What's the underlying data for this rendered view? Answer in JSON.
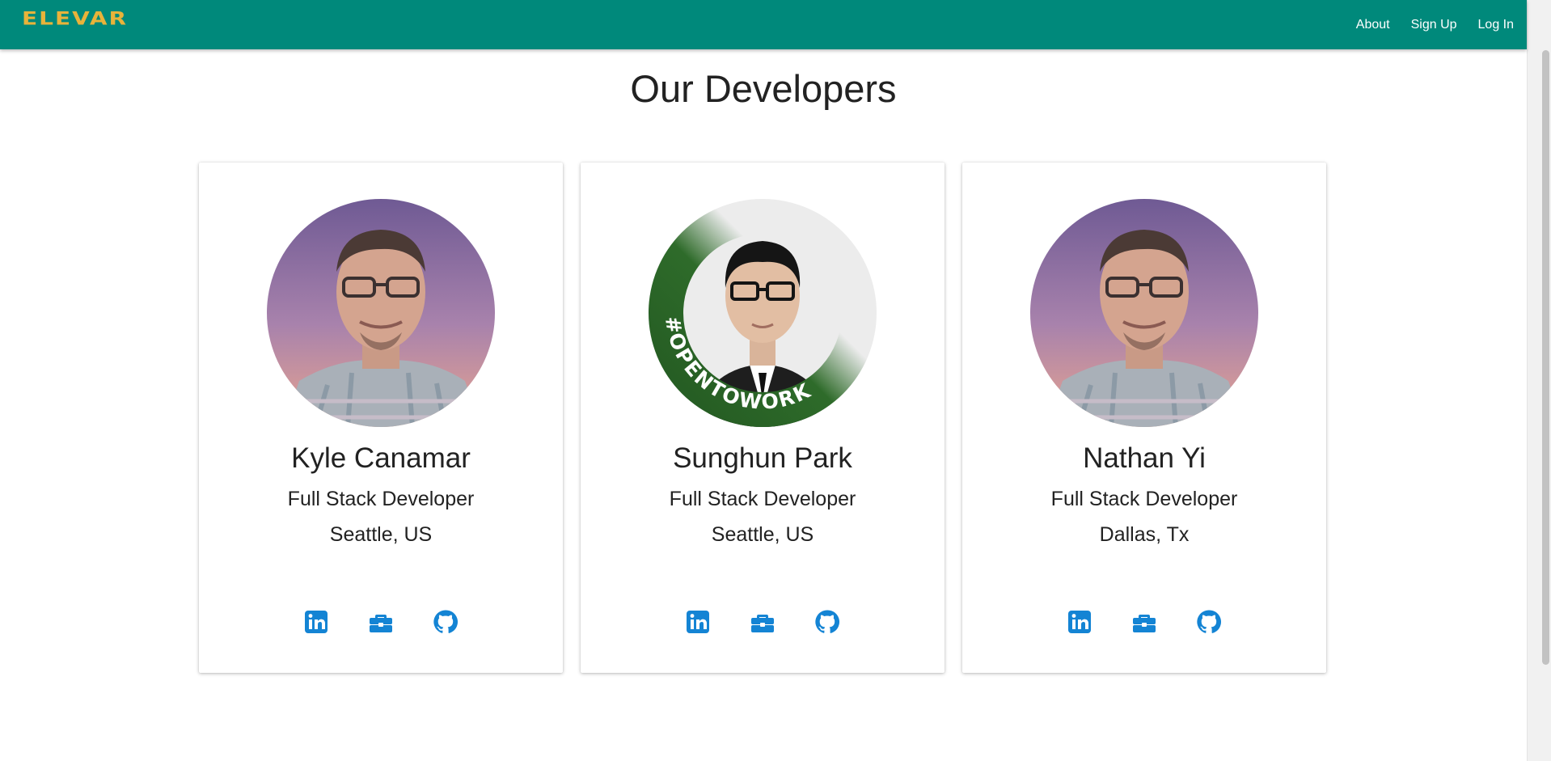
{
  "header": {
    "logo": "ELEVAR",
    "nav": [
      "About",
      "Sign Up",
      "Log In"
    ]
  },
  "page": {
    "title": "Our Developers"
  },
  "colors": {
    "appbar": "#00897b",
    "logo": "#e8b33a",
    "icon": "#1484d4",
    "opentowork_ring": "#2e6b2a"
  },
  "developers": [
    {
      "name": "Kyle Canamar",
      "role": "Full Stack Developer",
      "location": "Seattle, US",
      "avatar": "profile-photo",
      "links": [
        "linkedin-icon",
        "briefcase-icon",
        "github-icon"
      ]
    },
    {
      "name": "Sunghun Park",
      "role": "Full Stack Developer",
      "location": "Seattle, US",
      "avatar": "profile-photo-opentowork",
      "badge": "#OPENTOWORK",
      "links": [
        "linkedin-icon",
        "briefcase-icon",
        "github-icon"
      ]
    },
    {
      "name": "Nathan Yi",
      "role": "Full Stack Developer",
      "location": "Dallas, Tx",
      "avatar": "profile-photo",
      "links": [
        "linkedin-icon",
        "briefcase-icon",
        "github-icon"
      ]
    }
  ]
}
